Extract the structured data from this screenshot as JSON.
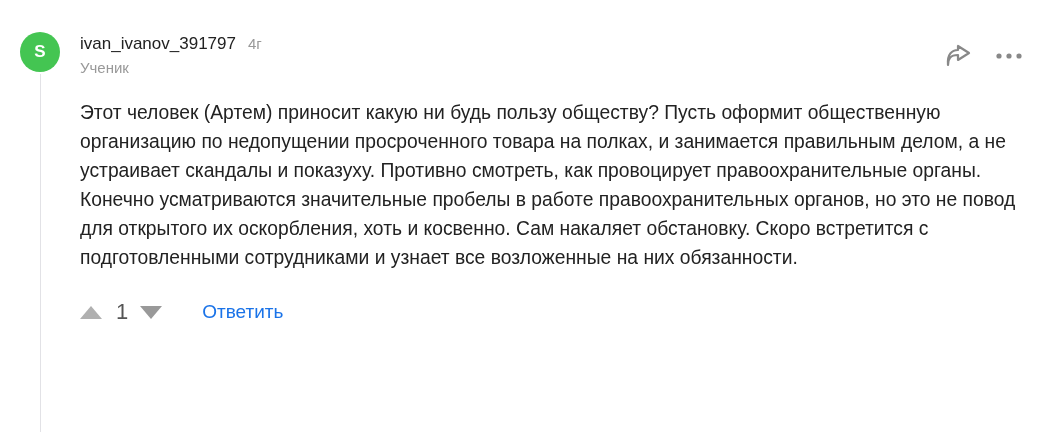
{
  "comment": {
    "avatar_letter": "S",
    "author": "ivan_ivanov_391797",
    "age": "4г",
    "rank": "Ученик",
    "text": "Этот человек (Артем) приносит какую ни будь пользу обществу? Пусть оформит общественную организацию по недопущении просроченного товара на полках, и занимается правильным делом, а не устраивает скандалы и показуху. Противно смотреть, как провоцирует правоохранительные органы. Конечно усматриваются значительные пробелы в работе правоохранительных органов, но это не повод для открытого их оскорбления, хоть и косвенно. Сам накаляет обстановку. Скоро встретится с подготовленными сотрудниками и узнает все возложенные на них обязанности.",
    "votes": "1",
    "reply": "Ответить"
  }
}
